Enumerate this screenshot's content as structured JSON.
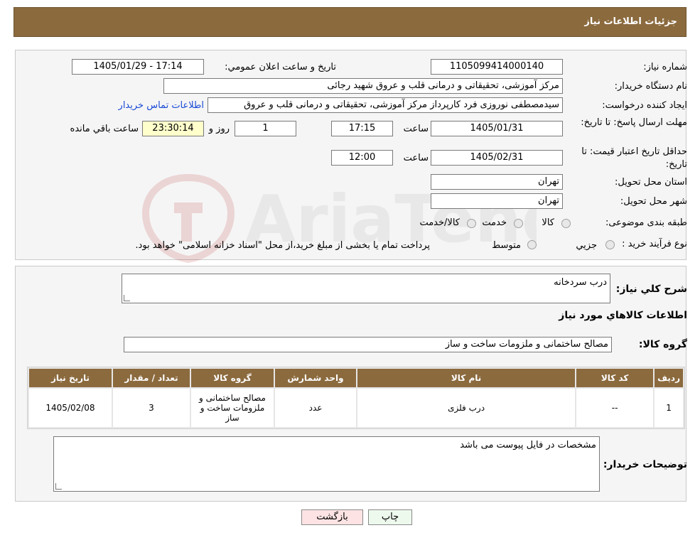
{
  "header": {
    "title": "جزئيات اطلاعات نياز"
  },
  "labels": {
    "need_number": "شماره نياز:",
    "announce_datetime": "تاريخ و ساعت اعلان عمومي:",
    "buyer_org": "نام دستگاه خريدار:",
    "requester": "ايجاد کننده درخواست:",
    "contact_link": "اطلاعات تماس خريدار",
    "send_deadline": "مهلت ارسال پاسخ: تا تاريخ:",
    "time": "ساعت",
    "day_and": "روز و",
    "remaining": "ساعت باقي مانده",
    "price_validity": "حداقل تاريخ اعتبار قيمت: تا تاريخ:",
    "province": "استان محل تحويل:",
    "city": "شهر محل تحويل:",
    "category": "طبقه بندی موضوعی:",
    "purchase_type": "نوع فرآيند خريد :",
    "payment_note": "پرداخت تمام يا بخشی از مبلغ خريد،از محل \"اسناد خزانه اسلامی\" خواهد بود.",
    "description": "شرح کلي نياز:",
    "items_info": "اطلاعات کالاهاي مورد نياز",
    "goods_group": "گروه کالا:",
    "buyer_notes": "توضيحات خريدار:"
  },
  "values": {
    "need_number": "1105099414000140",
    "announce_datetime": "1405/01/29 - 17:14",
    "buyer_org": "مرکز آموزشی، تحقیقاتی و درمانی قلب و عروق شهید رجائی",
    "requester": "سیدمصطفی نوروزی فرد کارپرداز مرکز آموزشی، تحقیقاتی و درمانی قلب و عروق",
    "send_date": "1405/01/31",
    "send_time": "17:15",
    "days_left": "1",
    "time_left": "23:30:14",
    "validity_date": "1405/02/31",
    "validity_time": "12:00",
    "province": "تهران",
    "city": "تهران",
    "description": "درب سردخانه",
    "goods_group": "مصالح ساختمانی و ملزومات ساخت و ساز",
    "buyer_notes": "مشخصات در فایل پیوست می باشد"
  },
  "category_options": [
    "کالا",
    "خدمت",
    "کالا/خدمت"
  ],
  "purchase_options": [
    "جزيي",
    "متوسط"
  ],
  "table": {
    "headers": [
      "رديف",
      "کد کالا",
      "نام کالا",
      "واحد شمارش",
      "گروه کالا",
      "تعداد / مقدار",
      "تاريخ نياز"
    ],
    "rows": [
      [
        "1",
        "--",
        "درب فلزی",
        "عدد",
        "مصالح ساختمانی و ملزومات ساخت و ساز",
        "3",
        "1405/02/08"
      ]
    ]
  },
  "buttons": {
    "print": "چاپ",
    "back": "بازگشت"
  },
  "colors": {
    "header": "#8b6a3e",
    "back_button": "#fde3e3",
    "print_button": "#eef9ee",
    "remaining_box": "#ffffcc"
  }
}
